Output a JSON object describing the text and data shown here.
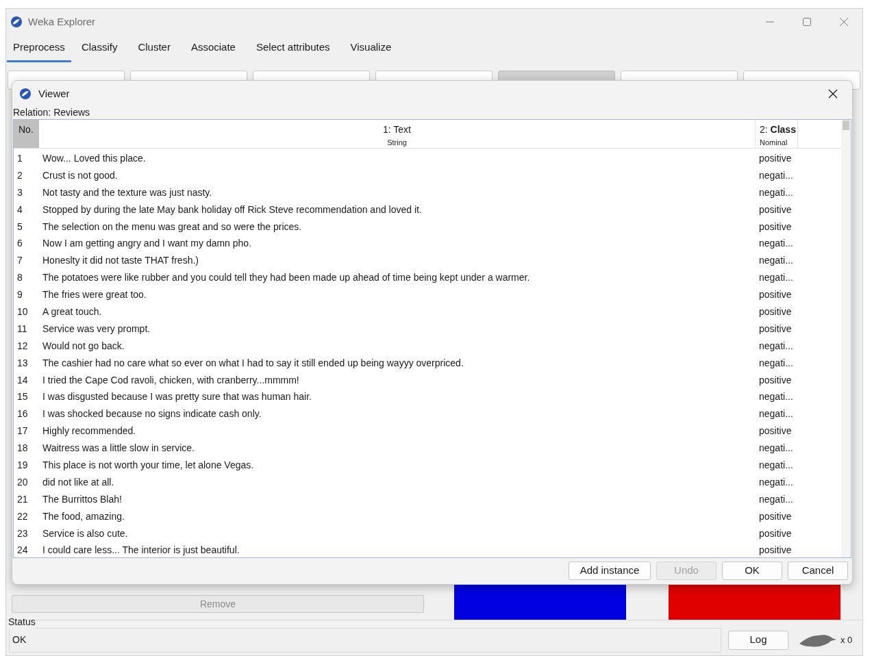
{
  "window": {
    "title": "Weka Explorer"
  },
  "tabs": [
    {
      "label": "Preprocess",
      "selected": true
    },
    {
      "label": "Classify",
      "selected": false
    },
    {
      "label": "Cluster",
      "selected": false
    },
    {
      "label": "Associate",
      "selected": false
    },
    {
      "label": "Select attributes",
      "selected": false
    },
    {
      "label": "Visualize",
      "selected": false
    }
  ],
  "toolbar": [
    {
      "disabled": false
    },
    {
      "disabled": false
    },
    {
      "disabled": false
    },
    {
      "disabled": false
    },
    {
      "disabled": true
    },
    {
      "disabled": false
    },
    {
      "disabled": false
    }
  ],
  "remove_button": {
    "label": "Remove",
    "disabled": true
  },
  "status": {
    "title": "Status",
    "message": "OK",
    "log_button": "Log",
    "count": "x 0"
  },
  "viewer": {
    "title": "Viewer",
    "relation": "Relation: Reviews",
    "columns": [
      {
        "label": "No."
      },
      {
        "label": "1: Text",
        "type": "String"
      },
      {
        "label": "2: **Class**",
        "type": "Nominal"
      }
    ],
    "rows": [
      {
        "no": "1",
        "text": "Wow... Loved this place.",
        "class": "positive"
      },
      {
        "no": "2",
        "text": "Crust is not good.",
        "class": "negati..."
      },
      {
        "no": "3",
        "text": "Not tasty and the texture was just nasty.",
        "class": "negati..."
      },
      {
        "no": "4",
        "text": "Stopped by during the late May bank holiday off Rick Steve recommendation and loved it.",
        "class": "positive"
      },
      {
        "no": "5",
        "text": "The selection on the menu was great and so were the prices.",
        "class": "positive"
      },
      {
        "no": "6",
        "text": "Now I am getting angry and I want my damn pho.",
        "class": "negati..."
      },
      {
        "no": "7",
        "text": "Honeslty it did not taste THAT fresh.)",
        "class": "negati..."
      },
      {
        "no": "8",
        "text": "The potatoes were like rubber and you could tell they had been made up ahead of time being kept under a warmer.",
        "class": "negati..."
      },
      {
        "no": "9",
        "text": "The fries were great too.",
        "class": "positive"
      },
      {
        "no": "10",
        "text": "A great touch.",
        "class": "positive"
      },
      {
        "no": "11",
        "text": "Service was very prompt.",
        "class": "positive"
      },
      {
        "no": "12",
        "text": "Would not go back.",
        "class": "negati..."
      },
      {
        "no": "13",
        "text": "The cashier had no care what so ever on what I had to say it still ended up being wayyy overpriced.",
        "class": "negati..."
      },
      {
        "no": "14",
        "text": "I tried the Cape Cod ravoli, chicken, with cranberry...mmmm!",
        "class": "positive"
      },
      {
        "no": "15",
        "text": "I was disgusted because I was pretty sure that was human hair.",
        "class": "negati..."
      },
      {
        "no": "16",
        "text": "I was shocked because no signs indicate cash only.",
        "class": "negati..."
      },
      {
        "no": "17",
        "text": "Highly recommended.",
        "class": "positive"
      },
      {
        "no": "18",
        "text": "Waitress was a little slow in service.",
        "class": "negati..."
      },
      {
        "no": "19",
        "text": "This place is not worth your time, let alone Vegas.",
        "class": "negati..."
      },
      {
        "no": "20",
        "text": "did not like at all.",
        "class": "negati..."
      },
      {
        "no": "21",
        "text": "The Burrittos Blah!",
        "class": "negati..."
      },
      {
        "no": "22",
        "text": "The food, amazing.",
        "class": "positive"
      },
      {
        "no": "23",
        "text": "Service is also cute.",
        "class": "positive"
      },
      {
        "no": "24",
        "text": "I could care less... The interior is just beautiful.",
        "class": "positive"
      }
    ],
    "buttons": [
      {
        "label": "Add instance",
        "disabled": false
      },
      {
        "label": "Undo",
        "disabled": true
      },
      {
        "label": "OK",
        "disabled": false
      },
      {
        "label": "Cancel",
        "disabled": false
      }
    ]
  }
}
